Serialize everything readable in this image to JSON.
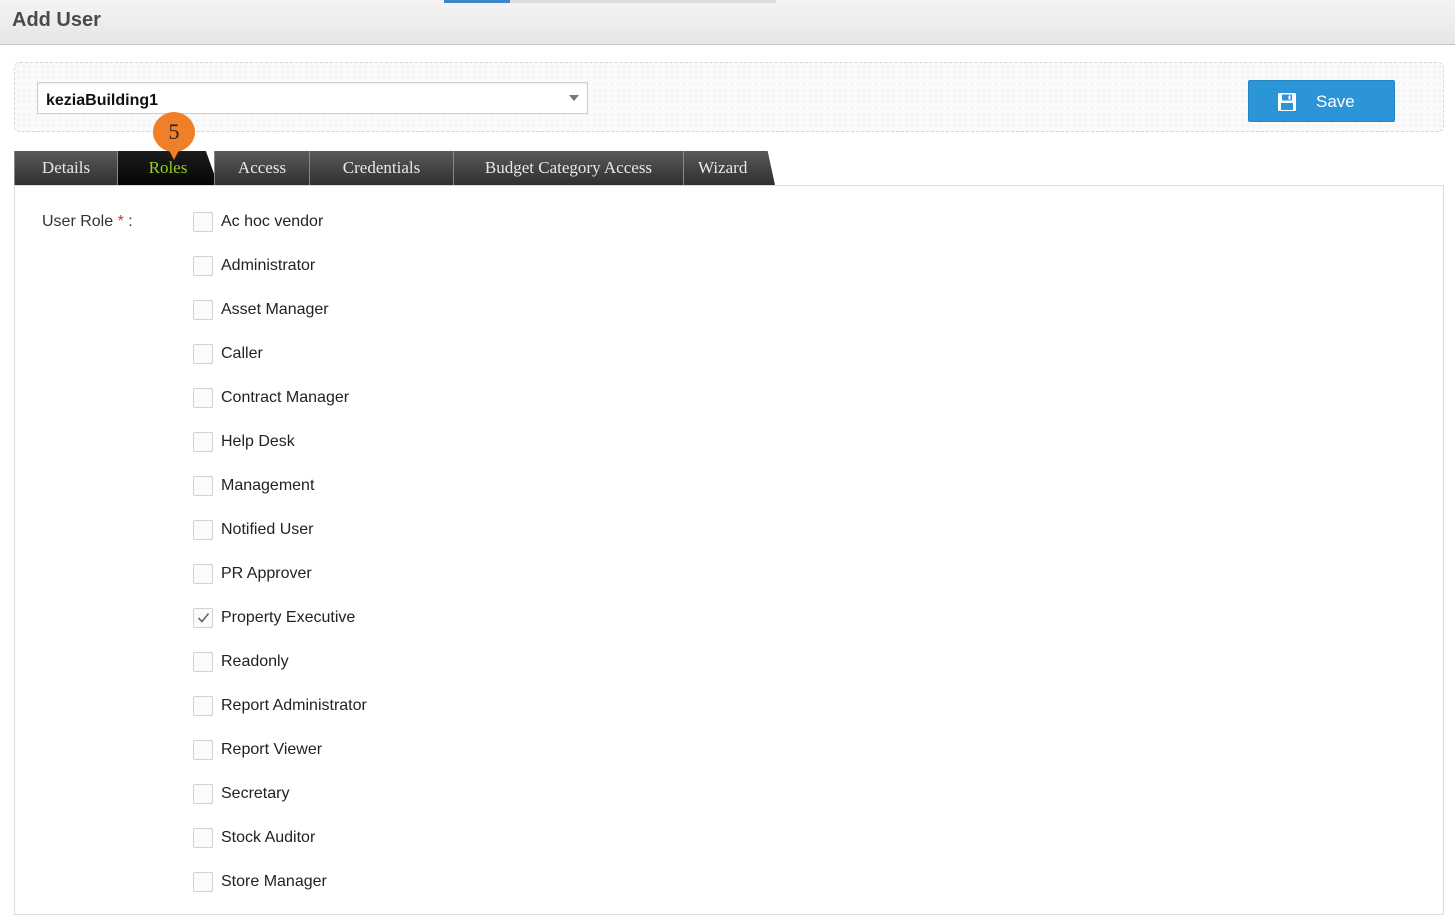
{
  "header": {
    "title": "Add User"
  },
  "toolbar": {
    "building_value": "keziaBuilding1",
    "save_label": "Save"
  },
  "tabs": [
    {
      "label": "Details"
    },
    {
      "label": "Roles",
      "active": true
    },
    {
      "label": "Access"
    },
    {
      "label": "Credentials"
    },
    {
      "label": "Budget Category Access"
    },
    {
      "label": "Wizard"
    }
  ],
  "form": {
    "role_label": "User Role",
    "required_mark": "*",
    "colon": ":"
  },
  "roles": [
    {
      "label": "Ac hoc vendor",
      "checked": false
    },
    {
      "label": "Administrator",
      "checked": false
    },
    {
      "label": "Asset Manager",
      "checked": false
    },
    {
      "label": "Caller",
      "checked": false
    },
    {
      "label": "Contract Manager",
      "checked": false
    },
    {
      "label": "Help Desk",
      "checked": false
    },
    {
      "label": "Management",
      "checked": false
    },
    {
      "label": "Notified User",
      "checked": false
    },
    {
      "label": "PR Approver",
      "checked": false
    },
    {
      "label": "Property Executive",
      "checked": true
    },
    {
      "label": "Readonly",
      "checked": false
    },
    {
      "label": "Report Administrator",
      "checked": false
    },
    {
      "label": "Report Viewer",
      "checked": false
    },
    {
      "label": "Secretary",
      "checked": false
    },
    {
      "label": "Stock Auditor",
      "checked": false
    },
    {
      "label": "Store Manager",
      "checked": false
    }
  ],
  "annotation": {
    "step_number": "5",
    "color": "#f07f2a"
  },
  "colors": {
    "save_button": "#2b95d8",
    "active_tab_text": "#95d11f",
    "tab_background": "#3a3a3a"
  }
}
